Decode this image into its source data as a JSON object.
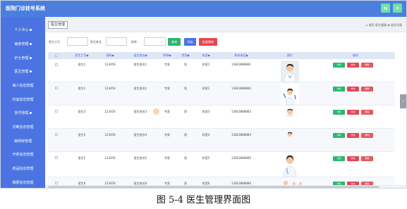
{
  "app": {
    "title": "医院门诊挂号系统"
  },
  "top_icons": [
    {
      "icon": "switch-icon",
      "glyph": "⇆"
    },
    {
      "icon": "close-icon",
      "glyph": "✕"
    }
  ],
  "sidebar": {
    "items": [
      {
        "label": "个人中心"
      },
      {
        "label": "病房管理"
      },
      {
        "label": "护士管理"
      },
      {
        "label": "医生管理"
      },
      {
        "label": "病人信息管理"
      },
      {
        "label": "科室信息管理"
      },
      {
        "label": "挂号管理"
      },
      {
        "label": "诊断信息管理"
      },
      {
        "label": "病例库管理"
      },
      {
        "label": "开药信息管理"
      },
      {
        "label": "药品信息管理"
      },
      {
        "label": "缴费信息管理"
      }
    ]
  },
  "page": {
    "tab": "医生管理",
    "breadcrumb": "⌂ 首页 医生管理 ✿ 医生列表"
  },
  "search": {
    "id_label": "医生工号",
    "name_label": "医生姓名",
    "title_label": "职称",
    "search_btn": "查询",
    "add_btn": "添加",
    "batch_delete_btn": "批量删除"
  },
  "table": {
    "headers": [
      "医生工号◆",
      "密码◆",
      "医生姓名◆",
      "职称◆",
      "性别◆",
      "科室◆",
      "联系电话◆",
      "照片",
      "操作"
    ],
    "rows": [
      [
        "医生1",
        "123456",
        "医生姓名1",
        "专家",
        "男",
        "科室1",
        "13823888881"
      ],
      [
        "医生2",
        "123456",
        "医生姓名2",
        "专家",
        "男",
        "科室2",
        "13823888882"
      ],
      [
        "医生3",
        "123456",
        "医生姓名3",
        "专家",
        "男",
        "科室3",
        "13823888883"
      ],
      [
        "医生4",
        "123456",
        "医生姓名4",
        "专家",
        "男",
        "科室4",
        "13823888884"
      ],
      [
        "医生5",
        "123456",
        "医生姓名5",
        "专家",
        "男",
        "科室5",
        "13823888885"
      ],
      [
        "医生6",
        "123456",
        "医生姓名6",
        "专家",
        "男",
        "科室6",
        "13823888886"
      ]
    ],
    "actions": {
      "detail": "详情",
      "edit": "修改",
      "delete": "删除"
    }
  },
  "caption": "图 5-4 医生管理界面图",
  "colors": {
    "topbar": "#4a7fe0",
    "sidebar": "#4b74e2",
    "accent_green": "#2bb673",
    "accent_red": "#e64552"
  }
}
